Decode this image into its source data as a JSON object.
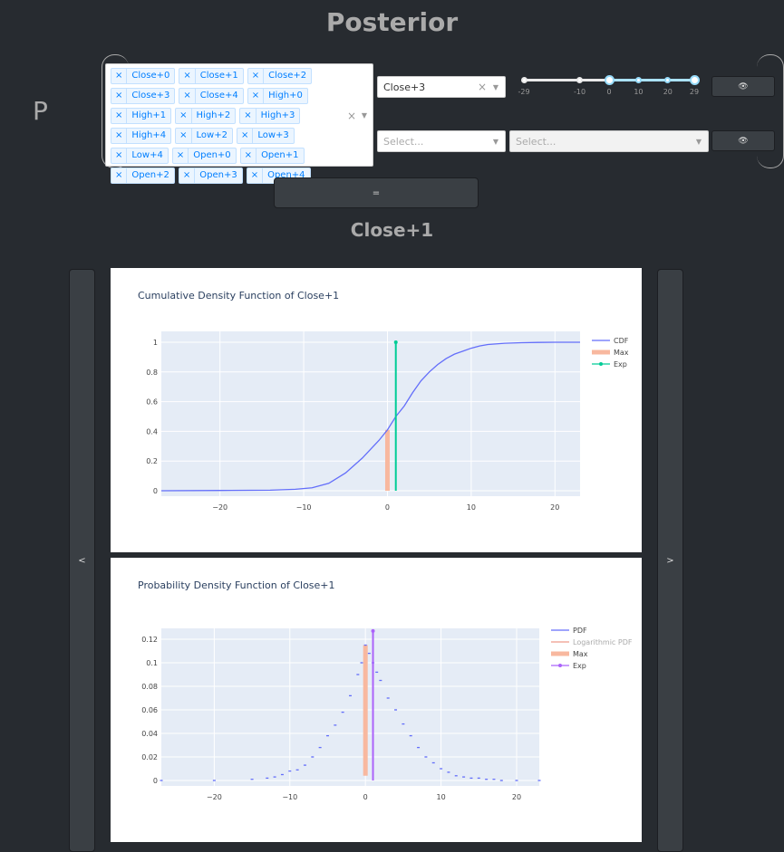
{
  "page": {
    "title": "Posterior",
    "p_label": "P",
    "subtitle": "Close+1"
  },
  "multi_select": {
    "chips": [
      "Close+0",
      "Close+1",
      "Close+2",
      "Close+3",
      "Close+4",
      "High+0",
      "High+1",
      "High+2",
      "High+3",
      "High+4",
      "Low+2",
      "Low+3",
      "Low+4",
      "Open+0",
      "Open+1",
      "Open+2",
      "Open+3",
      "Open+4"
    ],
    "remove_glyph": "×",
    "clear_glyph": "×",
    "arrow_glyph": "▼"
  },
  "controls": {
    "target_select_value": "Close+3",
    "select_a_placeholder": "Select...",
    "select_b_placeholder": "Select...",
    "eye_glyph": "👁",
    "equals_label": "=",
    "prev_label": "<",
    "next_label": ">"
  },
  "range_slider": {
    "marks": [
      "-29",
      "-10",
      "0",
      "10",
      "20",
      "29"
    ],
    "min": -29,
    "max": 29,
    "selected_range": [
      0,
      29
    ]
  },
  "colors": {
    "cdf": "#636efa",
    "max": "#f8b89f",
    "exp_cdf": "#00cc96",
    "exp_pdf": "#ab63fa",
    "plot_bg": "#e5ecf6",
    "log_pdf": "#ef9a8a"
  },
  "chart_data": [
    {
      "type": "line",
      "title": "Cumulative Density Function of Close+1",
      "xlim": [
        -27,
        23
      ],
      "ylim": [
        0,
        1
      ],
      "xticks": [
        -20,
        -10,
        0,
        10,
        20
      ],
      "xtick_labels": [
        "−20",
        "−10",
        "0",
        "10",
        "20"
      ],
      "yticks": [
        0,
        0.2,
        0.4,
        0.6,
        0.8,
        1
      ],
      "ytick_labels": [
        "0",
        "0.2",
        "0.4",
        "0.6",
        "0.8",
        "1"
      ],
      "legend": [
        "CDF",
        "Max",
        "Exp"
      ],
      "series": [
        {
          "name": "CDF",
          "x": [
            -27,
            -20,
            -14,
            -11,
            -9,
            -7,
            -5,
            -4,
            -3,
            -2,
            -1,
            0,
            1,
            2,
            3,
            4,
            5,
            6,
            7,
            8,
            9,
            10,
            11,
            12,
            14,
            16,
            18,
            20,
            23
          ],
          "y": [
            0,
            0.002,
            0.004,
            0.01,
            0.02,
            0.05,
            0.12,
            0.17,
            0.22,
            0.28,
            0.34,
            0.41,
            0.5,
            0.57,
            0.66,
            0.74,
            0.8,
            0.85,
            0.89,
            0.92,
            0.94,
            0.96,
            0.975,
            0.985,
            0.993,
            0.997,
            0.999,
            1,
            1
          ]
        },
        {
          "name": "Max",
          "x": [
            0,
            0
          ],
          "y": [
            0,
            0.41
          ]
        },
        {
          "name": "Exp",
          "x": [
            1,
            1
          ],
          "y": [
            0,
            1
          ]
        }
      ]
    },
    {
      "type": "scatter",
      "title": "Probability Density Function of Close+1",
      "xlim": [
        -27,
        23
      ],
      "ylim": [
        0,
        0.12
      ],
      "xticks": [
        -20,
        -10,
        0,
        10,
        20
      ],
      "xtick_labels": [
        "−20",
        "−10",
        "0",
        "10",
        "20"
      ],
      "yticks": [
        0,
        0.02,
        0.04,
        0.06,
        0.08,
        0.1,
        0.12
      ],
      "ytick_labels": [
        "0",
        "0.02",
        "0.04",
        "0.06",
        "0.08",
        "0.1",
        "0.12"
      ],
      "legend": [
        "PDF",
        "Logarithmic PDF",
        "Max",
        "Exp"
      ],
      "series": [
        {
          "name": "PDF",
          "x": [
            -27,
            -20,
            -15,
            -13,
            -12,
            -11,
            -10,
            -9,
            -8,
            -7,
            -6,
            -5,
            -4,
            -3,
            -2,
            -1,
            -0.5,
            0,
            0.5,
            1,
            1.5,
            2,
            3,
            4,
            5,
            6,
            7,
            8,
            9,
            10,
            11,
            12,
            13,
            14,
            15,
            16,
            17,
            18,
            20,
            23
          ],
          "y": [
            0,
            0,
            0.001,
            0.002,
            0.003,
            0.005,
            0.008,
            0.009,
            0.013,
            0.02,
            0.028,
            0.038,
            0.047,
            0.058,
            0.072,
            0.09,
            0.1,
            0.115,
            0.108,
            0.1,
            0.092,
            0.085,
            0.07,
            0.06,
            0.048,
            0.038,
            0.028,
            0.02,
            0.015,
            0.01,
            0.007,
            0.004,
            0.003,
            0.002,
            0.002,
            0.001,
            0.001,
            0,
            0,
            0
          ]
        },
        {
          "name": "Max",
          "x": [
            0,
            0
          ],
          "y": [
            0.004,
            0.115
          ]
        },
        {
          "name": "Exp",
          "x": [
            1,
            1
          ],
          "y": [
            0,
            0.127
          ]
        }
      ]
    }
  ]
}
